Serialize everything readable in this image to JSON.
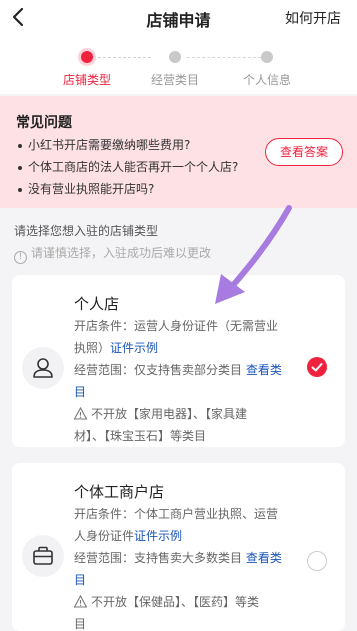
{
  "header": {
    "title": "店铺申请",
    "right_link": "如何开店"
  },
  "steps": [
    {
      "label": "店铺类型",
      "active": true
    },
    {
      "label": "经营类目",
      "active": false
    },
    {
      "label": "个人信息",
      "active": false
    }
  ],
  "faq": {
    "title": "常见问题",
    "items": [
      "小红书开店需要缴纳哪些费用?",
      "个体工商店的法人能否再开一个个人店?",
      "没有营业执照能开店吗?"
    ],
    "button_label": "查看答案"
  },
  "hints": {
    "select": "请选择您想入驻的店铺类型",
    "caution": "请谨慎选择，入驻成功后难以更改"
  },
  "store_types": [
    {
      "title": "个人店",
      "condition_line1": "开店条件：运营人身份证件（无需营业",
      "condition_line2": "执照）",
      "condition_link": "证件示例",
      "scope_line1": "经营范围：仅支持售卖部分类目",
      "scope_link1": "查看类",
      "scope_link2": "目",
      "restrict_line1": "不开放【家用电器】、【家具建",
      "restrict_line2": "材】、【珠宝玉石】等类目",
      "icon": "person-icon",
      "selected": true
    },
    {
      "title": "个体工商户店",
      "condition_line1": "开店条件：个体工商户营业执照、运营",
      "condition_line2": "人身份证件",
      "condition_link": "证件示例",
      "scope_line1": "经营范围：支持售卖大多数类目",
      "scope_link1": "查看类",
      "scope_link2": "目",
      "restrict_line1": "不开放【保健品】、【医药】等类",
      "restrict_line2": "目",
      "icon": "briefcase-icon",
      "selected": false
    }
  ],
  "colors": {
    "accent": "#f0233f",
    "link": "#1b55b8",
    "faq_bg": "#fde1e4",
    "annotation_arrow": "#a77be0"
  }
}
